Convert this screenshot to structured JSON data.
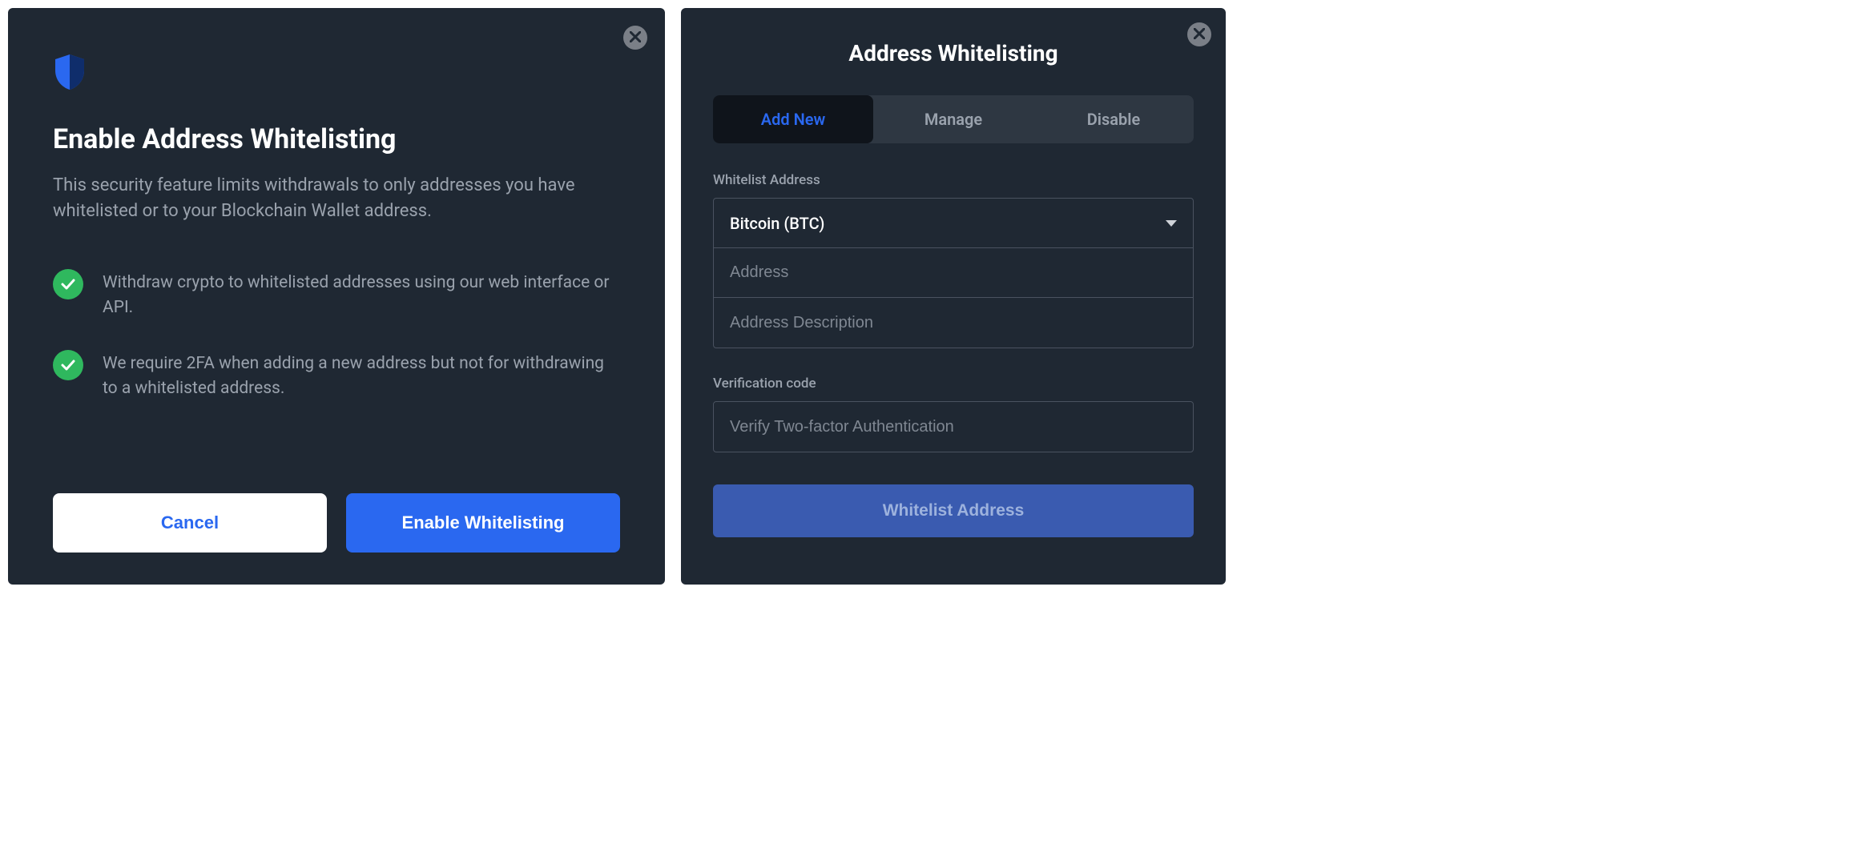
{
  "left": {
    "title": "Enable Address Whitelisting",
    "description": "This security feature limits withdrawals to only addresses you have whitelisted or to your Blockchain Wallet address.",
    "features": [
      "Withdraw crypto to whitelisted addresses using our web interface or API.",
      "We require 2FA when adding a new address but not for withdrawing to a whitelisted address."
    ],
    "cancel_label": "Cancel",
    "enable_label": "Enable Whitelisting"
  },
  "right": {
    "title": "Address Whitelisting",
    "tabs": {
      "add_new": "Add New",
      "manage": "Manage",
      "disable": "Disable"
    },
    "whitelist_section_label": "Whitelist Address",
    "asset_selected": "Bitcoin (BTC)",
    "address_placeholder": "Address",
    "description_placeholder": "Address Description",
    "verification_section_label": "Verification code",
    "verification_placeholder": "Verify Two-factor Authentication",
    "submit_label": "Whitelist Address"
  }
}
